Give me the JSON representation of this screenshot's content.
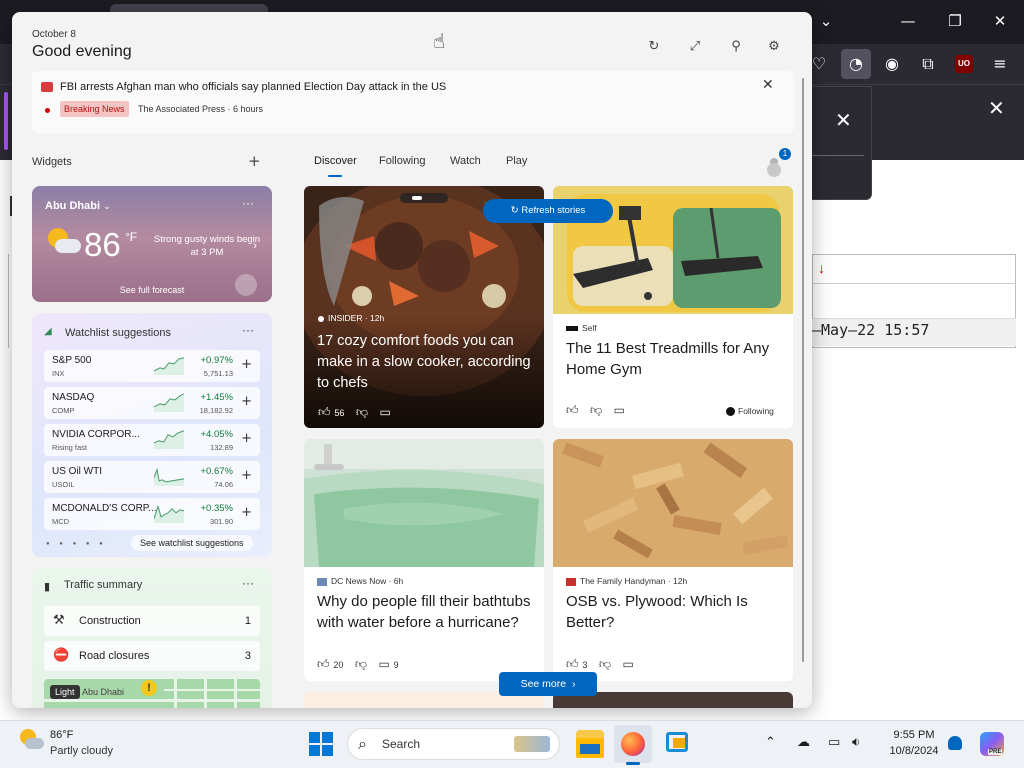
{
  "browser": {
    "window_controls": [
      "⌄",
      "—",
      "❐",
      "✕"
    ],
    "toolbar_icons": [
      "pocket-icon",
      "firefox-view-icon",
      "account-icon",
      "extensions-icon",
      "ublock-icon",
      "menu-icon"
    ],
    "ublock_label": "UO",
    "bg_date": "–May–22 15:57",
    "bg_arrow": "↓"
  },
  "widgets": {
    "date": "October 8",
    "greeting": "Good evening"
  },
  "breaking": {
    "headline": "FBI arrests Afghan man who officials say planned Election Day attack in the US",
    "badge": "Breaking News",
    "source": "The Associated Press · 6 hours"
  },
  "sidebar": {
    "label": "Widgets",
    "add": "+"
  },
  "weather": {
    "city": "Abu Dhabi",
    "temp": "86",
    "unit": "°F",
    "condition": "Strong gusty winds begin at 3 PM",
    "forecast_link": "See full forecast"
  },
  "watchlist": {
    "title": "Watchlist suggestions",
    "see_more": "See watchlist suggestions",
    "stocks": [
      {
        "name": "S&P 500",
        "sub": "INX",
        "change": "+0.97%",
        "price": "5,751.13"
      },
      {
        "name": "NASDAQ",
        "sub": "COMP",
        "change": "+1.45%",
        "price": "18,182.92"
      },
      {
        "name": "NVIDIA CORPOR...",
        "sub": "Rising fast",
        "change": "+4.05%",
        "price": "132.89"
      },
      {
        "name": "US Oil WTI",
        "sub": "USOIL",
        "change": "+0.67%",
        "price": "74.06"
      },
      {
        "name": "MCDONALD'S CORP...",
        "sub": "MCD",
        "change": "+0.35%",
        "price": "301.90"
      }
    ]
  },
  "traffic": {
    "title": "Traffic summary",
    "items": [
      {
        "label": "Construction",
        "count": "1"
      },
      {
        "label": "Road closures",
        "count": "3"
      }
    ],
    "map_light": "Light",
    "map_city": "Abu Dhabi"
  },
  "feed": {
    "tabs": [
      "Discover",
      "Following",
      "Watch",
      "Play"
    ],
    "refresh": "Refresh stories",
    "see_more": "See more",
    "notification_count": "1"
  },
  "cards": [
    {
      "source": "INSIDER · 12h",
      "title": "17 cozy comfort foods you can make in a slow cooker, according to chefs",
      "likes": "56"
    },
    {
      "source": "Self",
      "title": "The 11 Best Treadmills for Any Home Gym",
      "following": "Following"
    },
    {
      "source": "DC News Now · 6h",
      "title": "Why do people fill their bathtubs with water before a hurricane?",
      "likes": "20",
      "comments": "9"
    },
    {
      "source": "The Family Handyman · 12h",
      "title": "OSB vs. Plywood: Which Is Better?",
      "likes": "3"
    }
  ],
  "taskbar": {
    "temp": "86°F",
    "condition": "Partly cloudy",
    "search": "Search",
    "time": "9:55 PM",
    "date": "10/8/2024",
    "copilot_badge": "PRE"
  }
}
